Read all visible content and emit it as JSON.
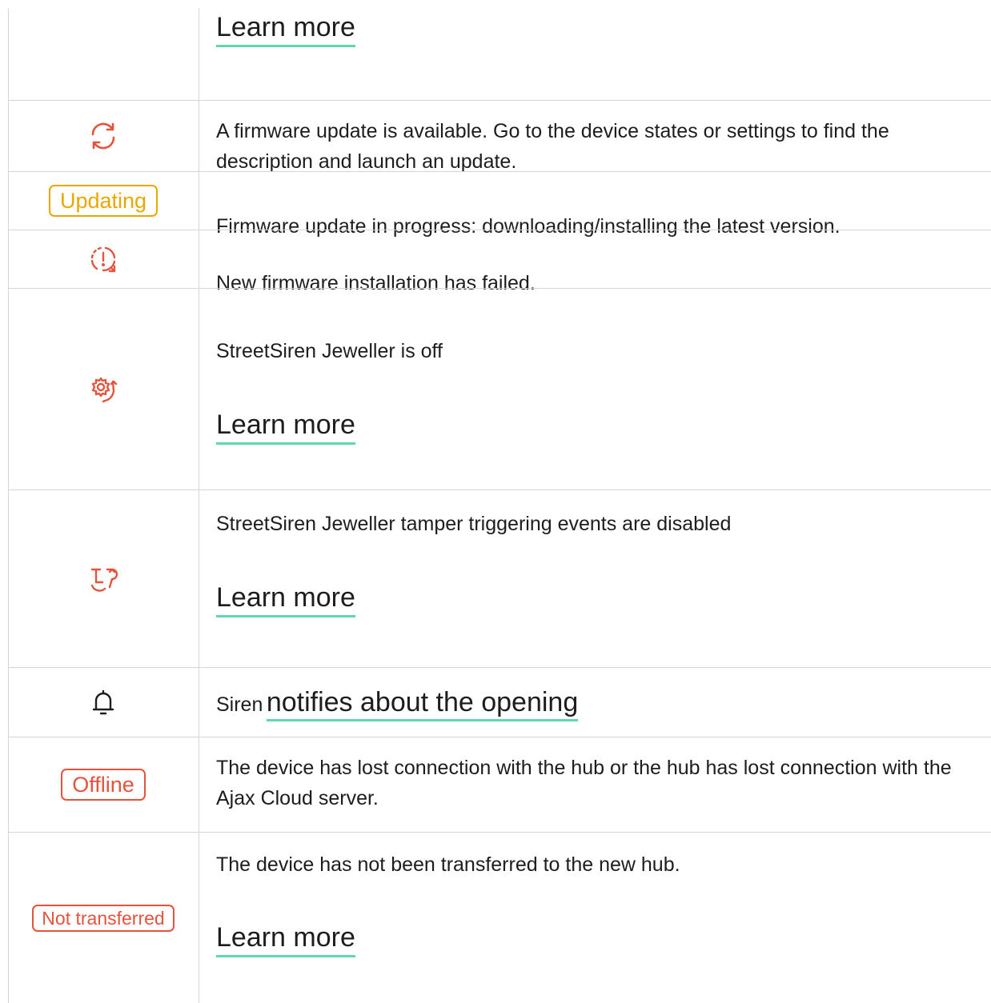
{
  "rows": [
    {
      "learn_more": "Learn more"
    },
    {
      "icon": "refresh-icon",
      "text": "A firmware update is available. Go to the device states or settings to find the description and launch an update."
    },
    {
      "badge": "Updating",
      "text": "Firmware update in progress: downloading/installing the latest version."
    },
    {
      "icon": "update-failed-icon",
      "text": "New firmware installation has failed."
    },
    {
      "icon": "jeweller-off-icon",
      "text": "StreetSiren Jeweller is off",
      "learn_more": "Learn more"
    },
    {
      "icon": "tamper-disabled-icon",
      "text": "StreetSiren Jeweller tamper triggering events are disabled",
      "learn_more": "Learn more"
    },
    {
      "icon": "bell-icon",
      "prefix": "Siren",
      "link": "notifies about the opening"
    },
    {
      "badge": "Offline",
      "text": "The device has lost connection with the hub or the hub has lost connection with the Ajax Cloud server."
    },
    {
      "badge": "Not transferred",
      "text": "The device has not been transferred to the new hub.",
      "learn_more": "Learn more"
    }
  ],
  "colors": {
    "alert": "#e5533d",
    "warning": "#e8a800",
    "link_underline": "#5ed9a9",
    "text": "#1d1d1d",
    "grid": "#d6d6d6"
  }
}
